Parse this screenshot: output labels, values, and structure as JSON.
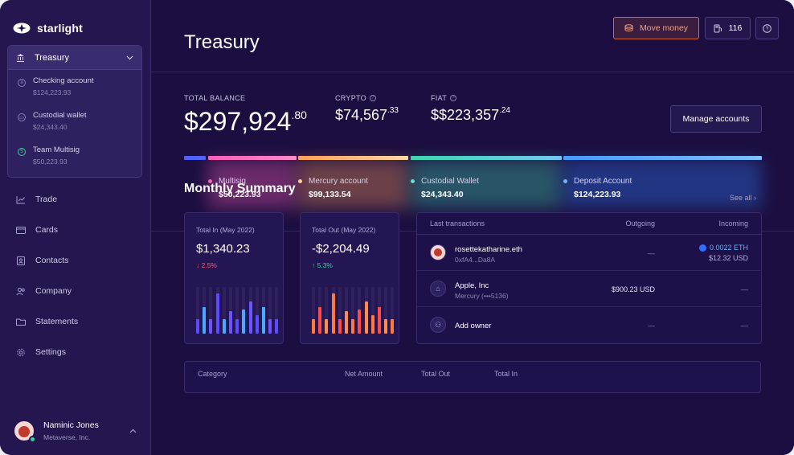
{
  "app": {
    "brand": "starlight"
  },
  "sidebar": {
    "treasury": {
      "label": "Treasury"
    },
    "accounts": [
      {
        "name": "Checking account",
        "value": "$124,223.93",
        "icon": "bank-icon"
      },
      {
        "name": "Custodial wallet",
        "value": "$24,343.40",
        "icon": "wallet-icon"
      },
      {
        "name": "Team Multisig",
        "value": "$50,223.93",
        "icon": "multisig-icon"
      }
    ],
    "nav": [
      {
        "label": "Trade",
        "icon": "chart-icon"
      },
      {
        "label": "Cards",
        "icon": "card-icon"
      },
      {
        "label": "Contacts",
        "icon": "contacts-icon"
      },
      {
        "label": "Company",
        "icon": "users-icon"
      },
      {
        "label": "Statements",
        "icon": "folder-icon"
      },
      {
        "label": "Settings",
        "icon": "gear-icon"
      }
    ],
    "user": {
      "name": "Naminic Jones",
      "org": "Metaverse, Inc."
    }
  },
  "header": {
    "title": "Treasury",
    "move_money": "Move money",
    "count": "116"
  },
  "balance": {
    "total_label": "TOTAL BALANCE",
    "total_main": "$297,924",
    "total_cents": ".80",
    "crypto_label": "CRYPTO",
    "crypto_main": "$74,567",
    "crypto_cents": ".33",
    "fiat_label": "FIAT",
    "fiat_main": "$$223,357",
    "fiat_cents": ".24",
    "manage": "Manage accounts"
  },
  "allocation": [
    {
      "name": "Multisig",
      "value": "$50,223.93",
      "color": "#ff5fb8"
    },
    {
      "name": "Mercury account",
      "value": "$99,133.54",
      "color": "#ffcf8a"
    },
    {
      "name": "Custodial Wallet",
      "value": "$24,343.40",
      "color": "#5fe0d0"
    },
    {
      "name": "Deposit Account",
      "value": "$124,223.93",
      "color": "#6fb7ff"
    }
  ],
  "summary": {
    "title": "Monthly Summary",
    "see_all": "See all",
    "total_in": {
      "label": "Total In (May 2022)",
      "amount": "$1,340.23",
      "change": "↓ 2.5%",
      "bars": [
        0.35,
        0.65,
        0.35,
        1.0,
        0.35,
        0.55,
        0.35,
        0.6,
        0.8,
        0.45,
        0.65,
        0.35,
        0.35
      ]
    },
    "total_out": {
      "label": "Total Out (May 2022)",
      "amount": "-$2,204.49",
      "change": "↑ 5.3%",
      "bars": [
        0.35,
        0.65,
        0.35,
        1.0,
        0.35,
        0.55,
        0.35,
        0.6,
        0.8,
        0.45,
        0.65,
        0.35,
        0.35
      ]
    }
  },
  "transactions": {
    "headers": {
      "last": "Last transactions",
      "outgoing": "Outgoing",
      "incoming": "Incoming"
    },
    "rows": [
      {
        "name": "rosettekatharine.eth",
        "sub": "0xfA4...Da8A",
        "outgoing": "—",
        "incoming": "0.0022 ETH",
        "incoming_sub": "$12.32 USD",
        "icon": "avatar-icon"
      },
      {
        "name": "Apple, Inc",
        "sub": "Mercury (•••5136)",
        "outgoing": "$900.23 USD",
        "incoming": "—",
        "incoming_sub": "",
        "icon": "bank-icon"
      },
      {
        "name": "Add owner",
        "sub": "",
        "outgoing": "—",
        "incoming": "—",
        "incoming_sub": "",
        "icon": "user-icon"
      }
    ]
  },
  "table": {
    "headers": [
      "Category",
      "Net Amount",
      "Total Out",
      "Total In"
    ]
  }
}
